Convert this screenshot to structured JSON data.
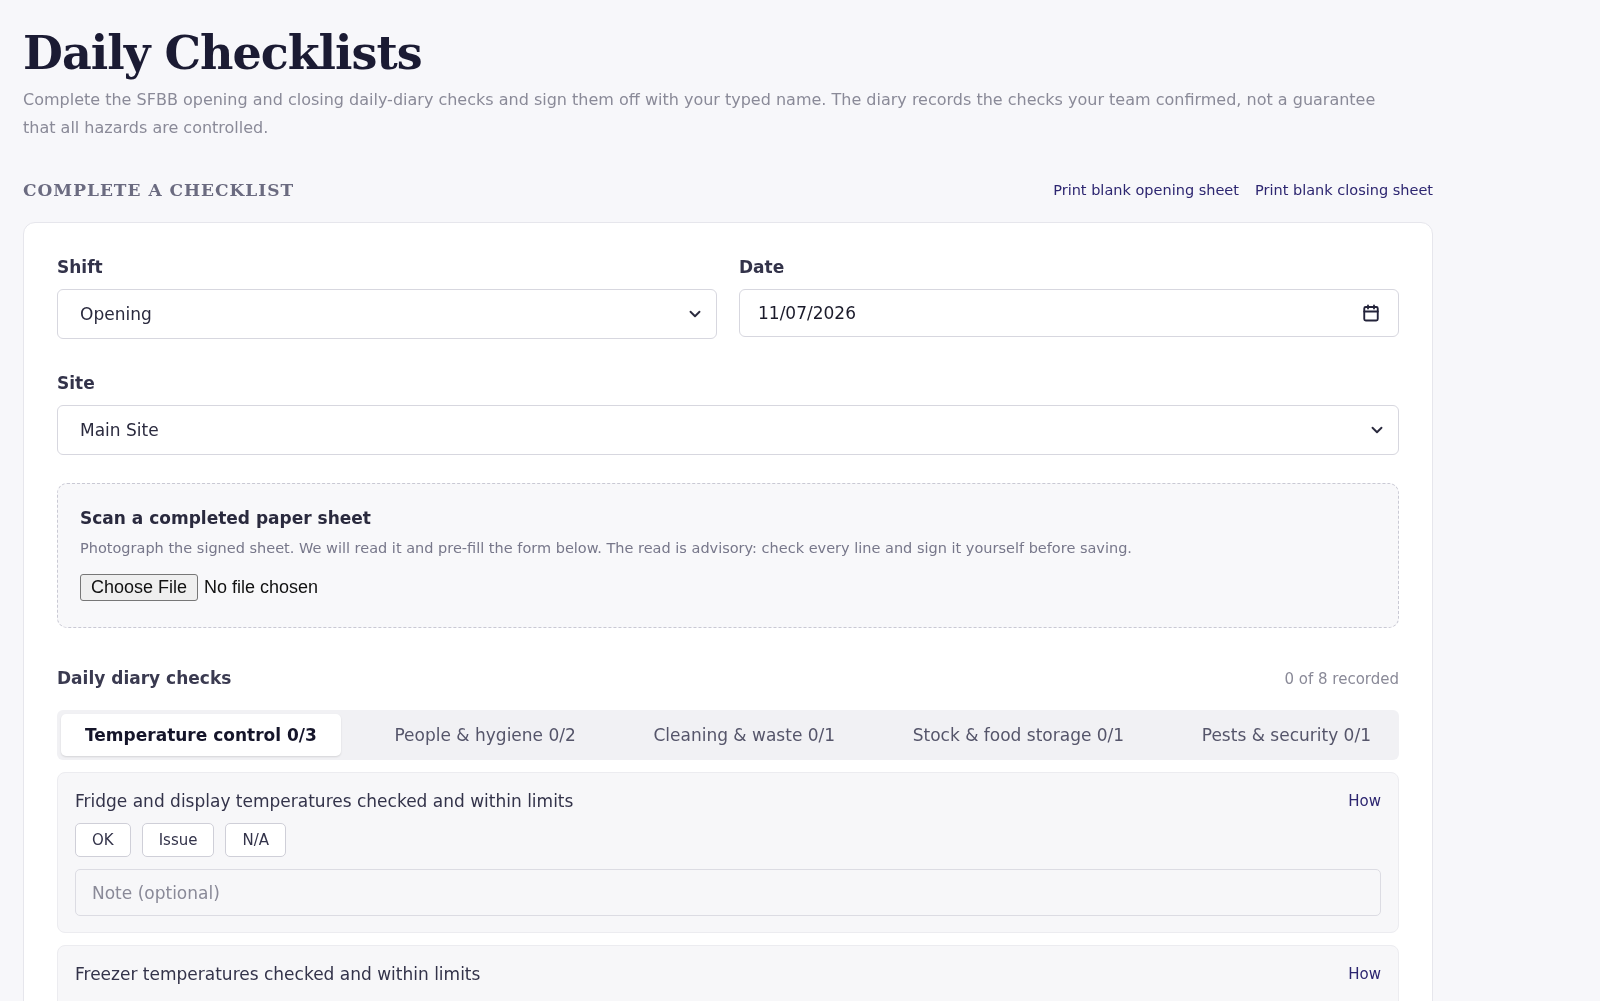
{
  "page": {
    "title": "Daily Checklists",
    "subtitle": "Complete the SFBB opening and closing daily-diary checks and sign them off with your typed name. The diary records the checks your team confirmed, not a guarantee that all hazards are controlled."
  },
  "section": {
    "heading": "COMPLETE A CHECKLIST",
    "links": [
      "Print blank opening sheet",
      "Print blank closing sheet"
    ]
  },
  "form": {
    "shift": {
      "label": "Shift",
      "value": "Opening"
    },
    "date": {
      "label": "Date",
      "value": "11/07/2026"
    },
    "site": {
      "label": "Site",
      "value": "Main Site"
    }
  },
  "scan": {
    "title": "Scan a completed paper sheet",
    "description": "Photograph the signed sheet. We will read it and pre-fill the form below. The read is advisory: check every line and sign it yourself before saving.",
    "button": "Choose File",
    "status": "No file chosen"
  },
  "checks": {
    "title": "Daily diary checks",
    "count": "0 of 8 recorded",
    "tabs": [
      {
        "label": "Temperature control 0/3",
        "selected": true
      },
      {
        "label": "People & hygiene 0/2",
        "selected": false
      },
      {
        "label": "Cleaning & waste 0/1",
        "selected": false
      },
      {
        "label": "Stock & food storage 0/1",
        "selected": false
      },
      {
        "label": "Pests & security 0/1",
        "selected": false
      }
    ],
    "items": [
      {
        "label": "Fridge and display temperatures checked and within limits",
        "help": "How",
        "options": [
          {
            "label": "OK",
            "selected": false
          },
          {
            "label": "Issue",
            "selected": false
          },
          {
            "label": "N/A",
            "selected": false
          }
        ],
        "note_placeholder": "Note (optional)"
      },
      {
        "label": "Freezer temperatures checked and within limits",
        "help": "How"
      }
    ]
  }
}
